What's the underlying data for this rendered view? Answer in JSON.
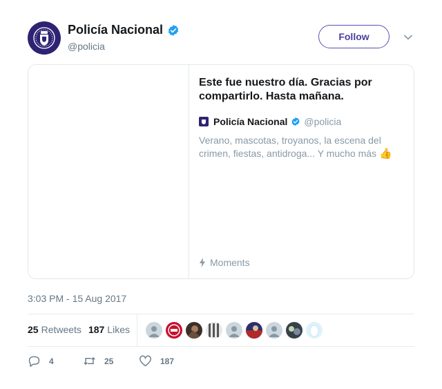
{
  "tweet": {
    "author": {
      "name": "Policía Nacional",
      "handle": "@policia",
      "verified": true
    },
    "follow_label": "Follow",
    "card": {
      "title": "Este fue nuestro día. Gracias por compartirlo. Hasta mañana.",
      "author_name": "Policía Nacional",
      "author_handle": "@policia",
      "description": "Verano, mascotas, troyanos, la escena del crimen, fiestas, antidroga... Y mucho más",
      "emoji": "👍",
      "footer_label": "Moments"
    },
    "timestamp": "3:03 PM - 15 Aug 2017",
    "stats": {
      "retweets_count": "25",
      "retweets_label": "Retweets",
      "likes_count": "187",
      "likes_label": "Likes"
    },
    "likers_count_shown": 9,
    "actions": {
      "replies": "4",
      "retweets": "25",
      "likes": "187"
    }
  },
  "colors": {
    "brand": "#2e2373",
    "follow_accent": "#4a3f9e",
    "verified_blue": "#1da1f2",
    "muted": "#657786"
  }
}
